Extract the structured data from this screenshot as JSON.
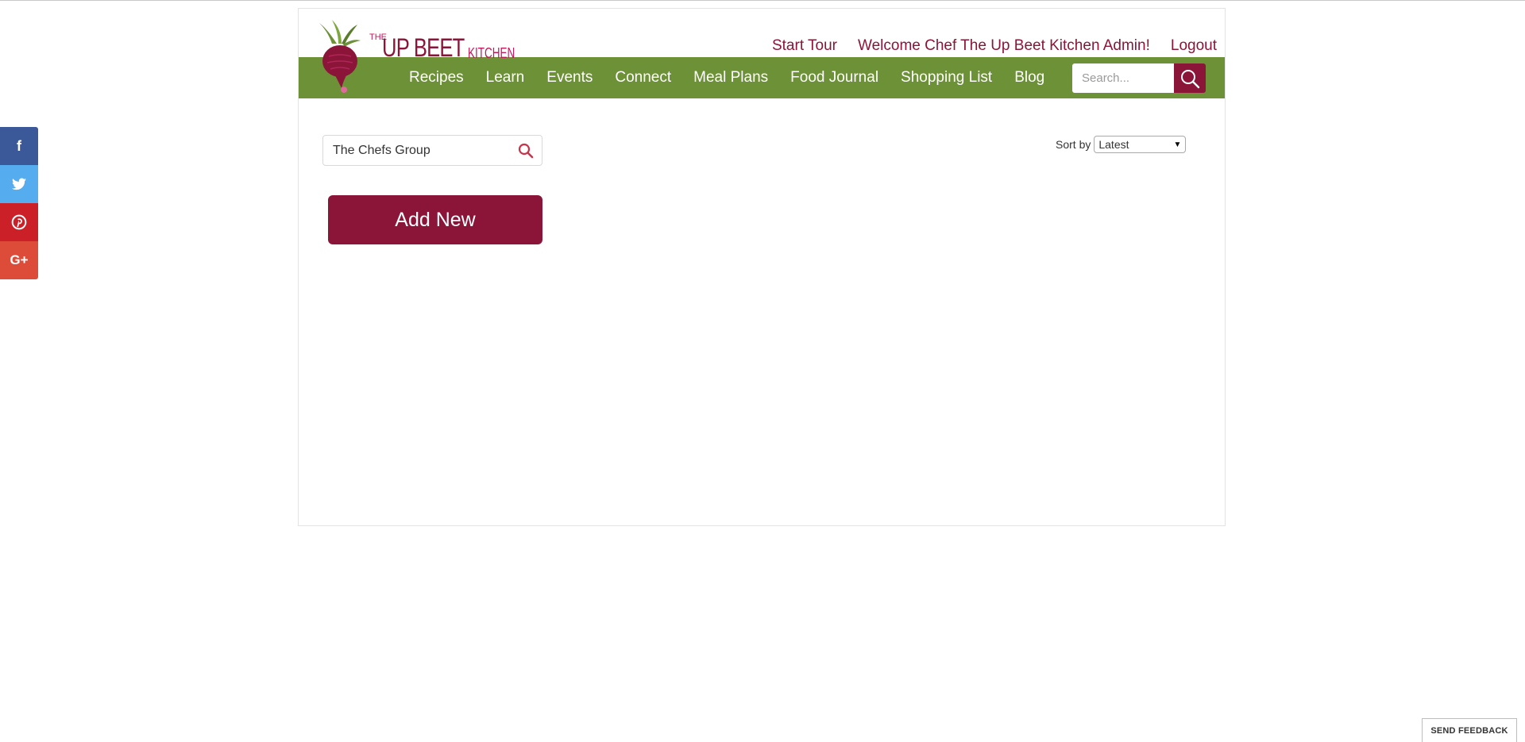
{
  "brand": {
    "logo_the": "THE",
    "logo_upbeet": "UP BEET",
    "logo_kitchen": "KITCHEN",
    "accent": "#8b1538",
    "nav_green": "#6c9136"
  },
  "header": {
    "start_tour": "Start Tour",
    "welcome": "Welcome Chef The Up Beet Kitchen Admin!",
    "logout": "Logout"
  },
  "nav": {
    "items": [
      {
        "label": "Recipes"
      },
      {
        "label": "Learn"
      },
      {
        "label": "Events"
      },
      {
        "label": "Connect"
      },
      {
        "label": "Meal Plans"
      },
      {
        "label": "Food Journal"
      },
      {
        "label": "Shopping List"
      },
      {
        "label": "Blog"
      }
    ],
    "search_placeholder": "Search...",
    "search_icon": "search-icon"
  },
  "social": {
    "items": [
      {
        "label": "f",
        "icon": "facebook-icon",
        "color": "#3b5998"
      },
      {
        "label": "twitter",
        "icon": "twitter-icon",
        "color": "#55acee"
      },
      {
        "label": "P",
        "icon": "pinterest-icon",
        "color": "#cb2027"
      },
      {
        "label": "G+",
        "icon": "google-plus-icon",
        "color": "#dd4b39"
      }
    ]
  },
  "main": {
    "group_search_value": "The Chefs Group",
    "add_new_label": "Add New",
    "sort_label": "Sort by",
    "sort_value": "Latest"
  },
  "feedback": {
    "label": "SEND FEEDBACK"
  }
}
